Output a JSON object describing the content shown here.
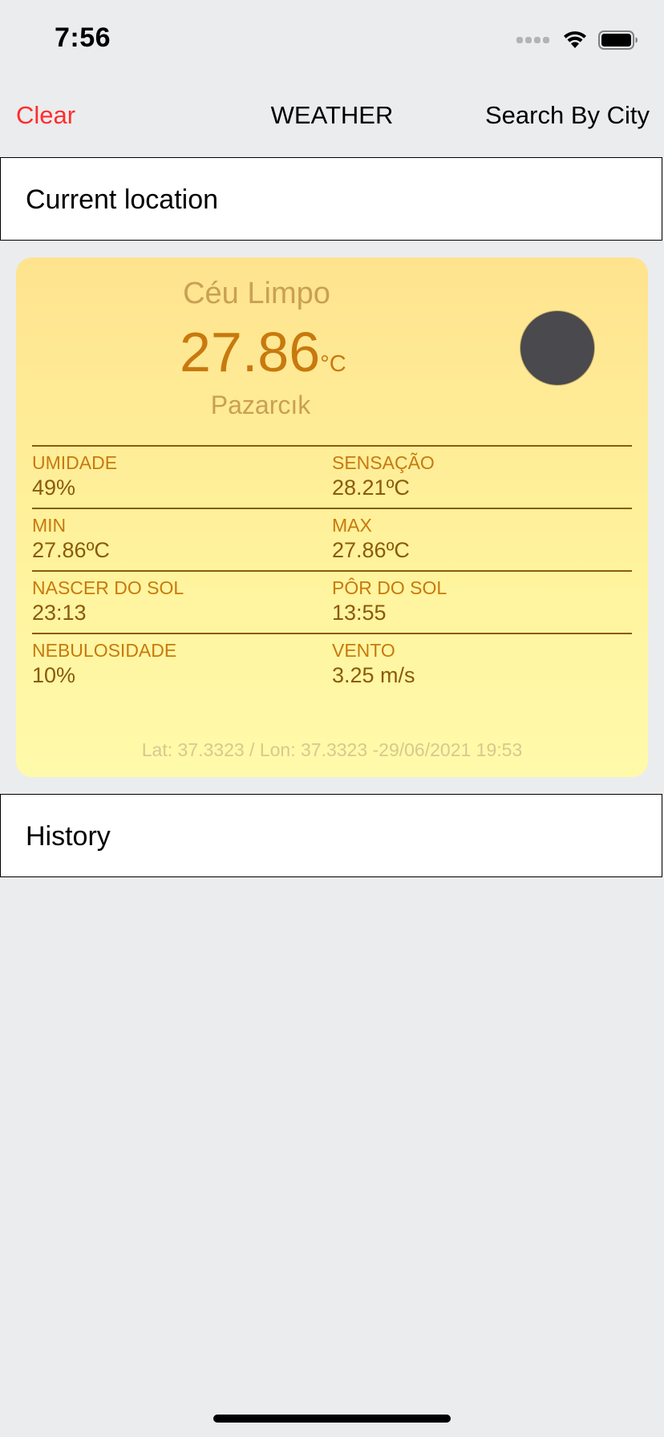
{
  "status_bar": {
    "time": "7:56"
  },
  "nav": {
    "clear_label": "Clear",
    "title": "WEATHER",
    "search_label": "Search By City"
  },
  "sections": {
    "current_location": "Current location",
    "history": "History"
  },
  "weather": {
    "condition": "Céu Limpo",
    "temperature": "27.86",
    "temperature_unit": "°C",
    "city": "Pazarcık",
    "icon": "weather-icon",
    "details": [
      {
        "left": {
          "label": "UMIDADE",
          "value": "49%"
        },
        "right": {
          "label": "SENSAÇÃO",
          "value": "28.21ºC"
        }
      },
      {
        "left": {
          "label": "MIN",
          "value": "27.86ºC"
        },
        "right": {
          "label": "MAX",
          "value": "27.86ºC"
        }
      },
      {
        "left": {
          "label": "NASCER DO SOL",
          "value": "23:13"
        },
        "right": {
          "label": "PÔR DO SOL",
          "value": "13:55"
        }
      },
      {
        "left": {
          "label": "NEBULOSIDADE",
          "value": "10%"
        },
        "right": {
          "label": "VENTO",
          "value": "3.25 m/s"
        }
      }
    ],
    "footer": "Lat: 37.3323 / Lon: 37.3323 -29/06/2021 19:53"
  },
  "colors": {
    "clear_button": "#ff2d2d",
    "card_gradient_top": "#ffe38f",
    "card_gradient_bottom": "#fffaaa",
    "label_orange": "#c8790e",
    "value_brown": "#8b5a0b"
  }
}
